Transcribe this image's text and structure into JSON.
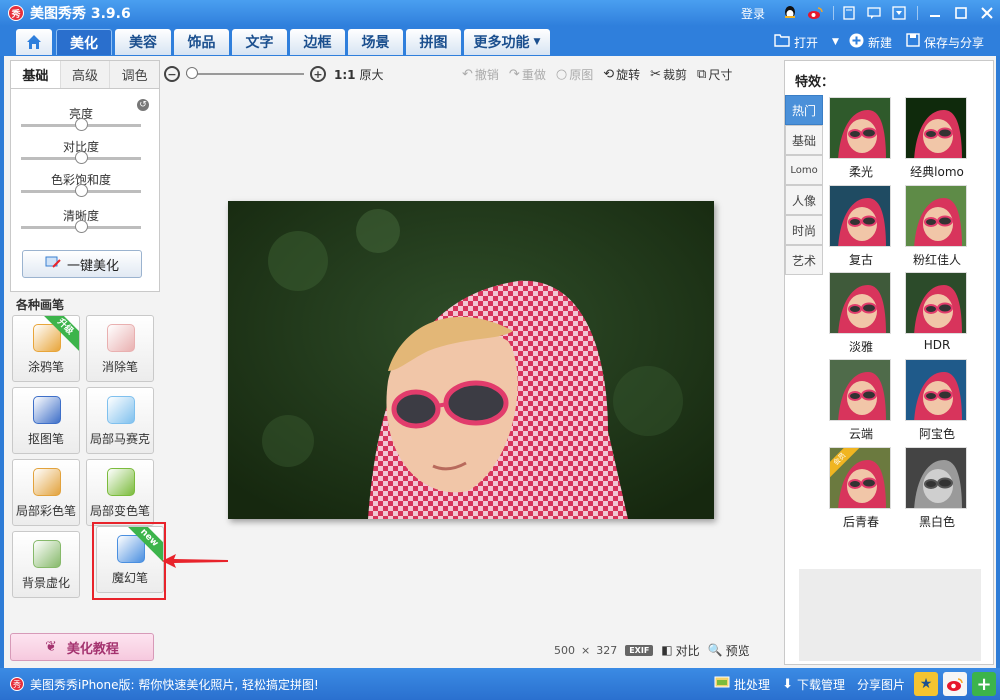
{
  "app": {
    "title": "美图秀秀 3.9.6",
    "logo_text": "秀",
    "login_label": "登录"
  },
  "nav": {
    "tabs": [
      "美化",
      "美容",
      "饰品",
      "文字",
      "边框",
      "场景",
      "拼图",
      "更多功能"
    ],
    "open_label": "打开",
    "new_label": "新建",
    "save_label": "保存与分享"
  },
  "adjust": {
    "tabs": [
      "基础",
      "高级",
      "调色"
    ],
    "sliders": [
      {
        "label": "亮度",
        "value": 0.5
      },
      {
        "label": "对比度",
        "value": 0.5
      },
      {
        "label": "色彩饱和度",
        "value": 0.5
      },
      {
        "label": "清晰度",
        "value": 0.5
      }
    ],
    "one_click_label": "一键美化"
  },
  "pens": {
    "title": "各种画笔",
    "items": [
      {
        "label": "涂鸦笔",
        "ribbon": "升级",
        "color": "#e8a53a"
      },
      {
        "label": "消除笔",
        "ribbon": "",
        "color": "#e9b0b0"
      },
      {
        "label": "抠图笔",
        "ribbon": "",
        "color": "#3e6fc8"
      },
      {
        "label": "局部马赛克",
        "ribbon": "",
        "color": "#7fc0ee"
      },
      {
        "label": "局部彩色笔",
        "ribbon": "",
        "color": "#e2a23c"
      },
      {
        "label": "局部变色笔",
        "ribbon": "",
        "color": "#7bbb3c"
      },
      {
        "label": "背景虚化",
        "ribbon": "",
        "color": "#86b96a"
      },
      {
        "label": "魔幻笔",
        "ribbon": "new",
        "color": "#4a8fe0"
      }
    ]
  },
  "tutorial": {
    "label": "美化教程"
  },
  "toolbar": {
    "zoom_ratio": "1:1",
    "zoom_original": "原大",
    "undo": "撤销",
    "redo": "重做",
    "original": "原图",
    "rotate": "旋转",
    "crop": "裁剪",
    "size": "尺寸"
  },
  "image_info": {
    "width": "500",
    "times": "×",
    "height": "327",
    "exif": "EXIF",
    "compare": "对比",
    "preview": "预览"
  },
  "effects": {
    "title": "特效：",
    "categories": [
      "热门",
      "基础",
      "Lomo",
      "人像",
      "时尚",
      "艺术"
    ],
    "items": [
      {
        "label": "柔光",
        "tone": "#2f5a2b",
        "tag": ""
      },
      {
        "label": "经典lomo",
        "tone": "#0f2a0c",
        "tag": ""
      },
      {
        "label": "复古",
        "tone": "#1f4b62",
        "tag": ""
      },
      {
        "label": "粉红佳人",
        "tone": "#5e8b47",
        "tag": ""
      },
      {
        "label": "淡雅",
        "tone": "#3f5a3a",
        "tag": ""
      },
      {
        "label": "HDR",
        "tone": "#2c4b2a",
        "tag": ""
      },
      {
        "label": "云端",
        "tone": "#4f6b4a",
        "tag": ""
      },
      {
        "label": "阿宝色",
        "tone": "#1f5a8a",
        "tag": ""
      },
      {
        "label": "后青春",
        "tone": "#6b7a3f",
        "tag": "会员"
      },
      {
        "label": "黑白色",
        "tone": "#444444",
        "tag": ""
      }
    ]
  },
  "bottom": {
    "promo": "美图秀秀iPhone版: 帮你快速美化照片, 轻松搞定拼图!",
    "batch_label": "批处理",
    "download_label": "下载管理",
    "share_label": "分享图片"
  }
}
